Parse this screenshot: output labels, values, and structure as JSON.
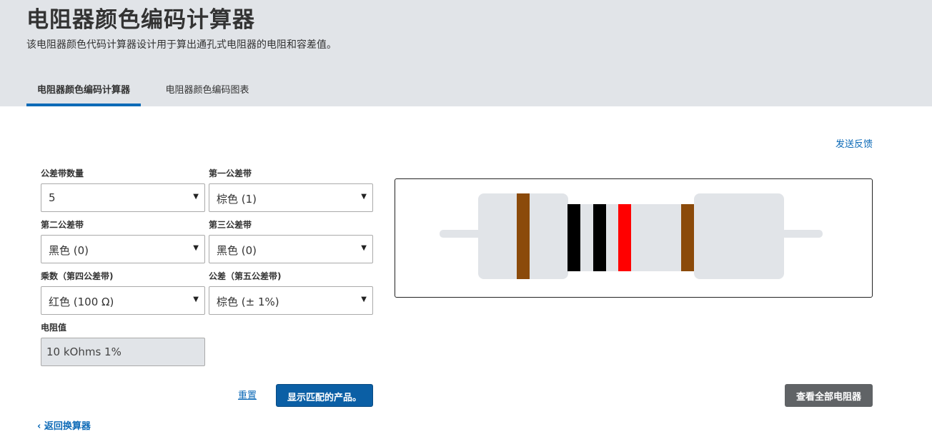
{
  "header": {
    "title": "电阻器颜色编码计算器",
    "subtitle": "该电阻器颜色代码计算器设计用于算出通孔式电阻器的电阻和容差值。",
    "tabs": [
      {
        "label": "电阻器颜色编码计算器",
        "active": true
      },
      {
        "label": "电阻器颜色编码图表",
        "active": false
      }
    ]
  },
  "feedback_link": "发送反馈",
  "form": {
    "band_count": {
      "label": "公差带数量",
      "value": "5"
    },
    "band1": {
      "label": "第一公差带",
      "value": "棕色 (1)"
    },
    "band2": {
      "label": "第二公差带",
      "value": "黑色 (0)"
    },
    "band3": {
      "label": "第三公差带",
      "value": "黑色 (0)"
    },
    "multiplier": {
      "label": "乘数（第四公差带)",
      "value": "红色 (100 Ω)"
    },
    "tolerance": {
      "label": "公差（第五公差带)",
      "value": "棕色 (± 1%)"
    },
    "resistance": {
      "label": "电阻值",
      "value": "10 kOhms 1%"
    }
  },
  "actions": {
    "reset": "重置",
    "show_products": "显示匹配的产品。",
    "view_all": "查看全部电阻器",
    "back": "返回换算器"
  },
  "icons": {
    "back": "chevron-left-icon",
    "dropdown": "caret-down-icon"
  },
  "resistor": {
    "bands": [
      {
        "name": "band1",
        "color": "#8b4a0a"
      },
      {
        "name": "band2",
        "color": "#000000"
      },
      {
        "name": "band3",
        "color": "#000000"
      },
      {
        "name": "multiplier",
        "color": "#ff0000"
      },
      {
        "name": "tolerance",
        "color": "#8b4a0a"
      }
    ],
    "body_color": "#e1e4e8",
    "lead_color": "#e1e4e8"
  }
}
